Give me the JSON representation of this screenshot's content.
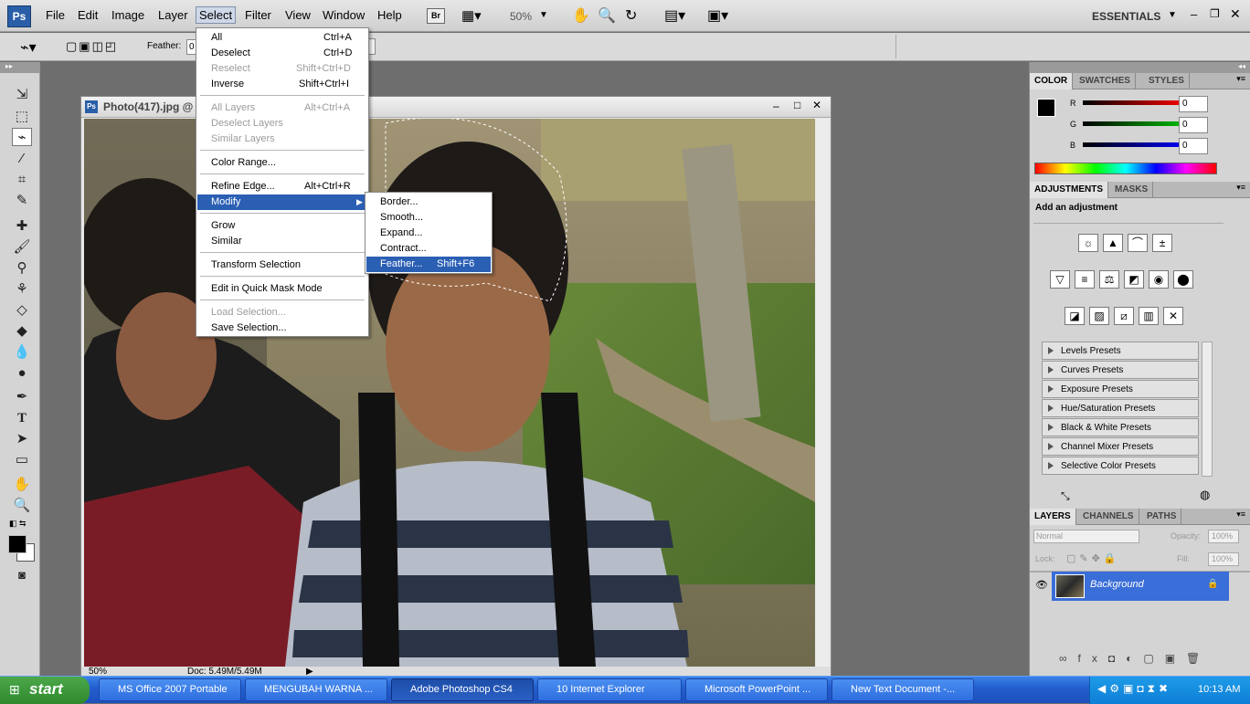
{
  "menubar": {
    "logo": "Ps",
    "items": [
      "File",
      "Edit",
      "Image",
      "Layer",
      "Select",
      "Filter",
      "View",
      "Window",
      "Help"
    ],
    "zoom": "50%",
    "workspace": "ESSENTIALS",
    "br_label": "Br"
  },
  "options": {
    "feather_label": "Feather:",
    "feather_value": "0"
  },
  "document": {
    "title": "Photo(417).jpg @",
    "status_zoom": "50%",
    "status_doc": "Doc: 5.49M/5.49M"
  },
  "select_menu": {
    "items": [
      {
        "label": "All",
        "shortcut": "Ctrl+A",
        "disabled": false
      },
      {
        "label": "Deselect",
        "shortcut": "Ctrl+D",
        "disabled": false
      },
      {
        "label": "Reselect",
        "shortcut": "Shift+Ctrl+D",
        "disabled": true
      },
      {
        "label": "Inverse",
        "shortcut": "Shift+Ctrl+I",
        "disabled": false
      },
      {
        "label": "All Layers",
        "shortcut": "Alt+Ctrl+A",
        "disabled": true
      },
      {
        "label": "Deselect Layers",
        "shortcut": "",
        "disabled": true
      },
      {
        "label": "Similar Layers",
        "shortcut": "",
        "disabled": true
      },
      {
        "label": "Color Range...",
        "shortcut": "",
        "disabled": false
      },
      {
        "label": "Refine Edge...",
        "shortcut": "Alt+Ctrl+R",
        "disabled": false
      },
      {
        "label": "Modify",
        "shortcut": "",
        "disabled": false
      },
      {
        "label": "Grow",
        "shortcut": "",
        "disabled": false
      },
      {
        "label": "Similar",
        "shortcut": "",
        "disabled": false
      },
      {
        "label": "Transform Selection",
        "shortcut": "",
        "disabled": false
      },
      {
        "label": "Edit in Quick Mask Mode",
        "shortcut": "",
        "disabled": false
      },
      {
        "label": "Load Selection...",
        "shortcut": "",
        "disabled": true
      },
      {
        "label": "Save Selection...",
        "shortcut": "",
        "disabled": false
      }
    ]
  },
  "modify_menu": {
    "items": [
      {
        "label": "Border...",
        "shortcut": ""
      },
      {
        "label": "Smooth...",
        "shortcut": ""
      },
      {
        "label": "Expand...",
        "shortcut": ""
      },
      {
        "label": "Contract...",
        "shortcut": ""
      },
      {
        "label": "Feather...",
        "shortcut": "Shift+F6"
      }
    ]
  },
  "color_panel": {
    "tabs": [
      "COLOR",
      "SWATCHES",
      "STYLES"
    ],
    "channels": [
      {
        "label": "R",
        "value": "0",
        "color": "#ff0000"
      },
      {
        "label": "G",
        "value": "0",
        "color": "#00c000"
      },
      {
        "label": "B",
        "value": "0",
        "color": "#0000ff"
      }
    ]
  },
  "adjustments_panel": {
    "tabs": [
      "ADJUSTMENTS",
      "MASKS"
    ],
    "heading": "Add an adjustment",
    "presets": [
      "Levels Presets",
      "Curves Presets",
      "Exposure Presets",
      "Hue/Saturation Presets",
      "Black & White Presets",
      "Channel Mixer Presets",
      "Selective Color Presets"
    ]
  },
  "layers_panel": {
    "tabs": [
      "LAYERS",
      "CHANNELS",
      "PATHS"
    ],
    "blend_mode": "Normal",
    "opacity_label": "Opacity:",
    "opacity_value": "100%",
    "lock_label": "Lock:",
    "fill_label": "Fill:",
    "fill_value": "100%",
    "layer_name": "Background"
  },
  "taskbar": {
    "start": "start",
    "buttons": [
      "MS Office 2007 Portable",
      "MENGUBAH WARNA ...",
      "Adobe Photoshop CS4",
      "10 Internet Explorer",
      "Microsoft PowerPoint ...",
      "New Text Document -..."
    ],
    "clock": "10:13 AM"
  }
}
